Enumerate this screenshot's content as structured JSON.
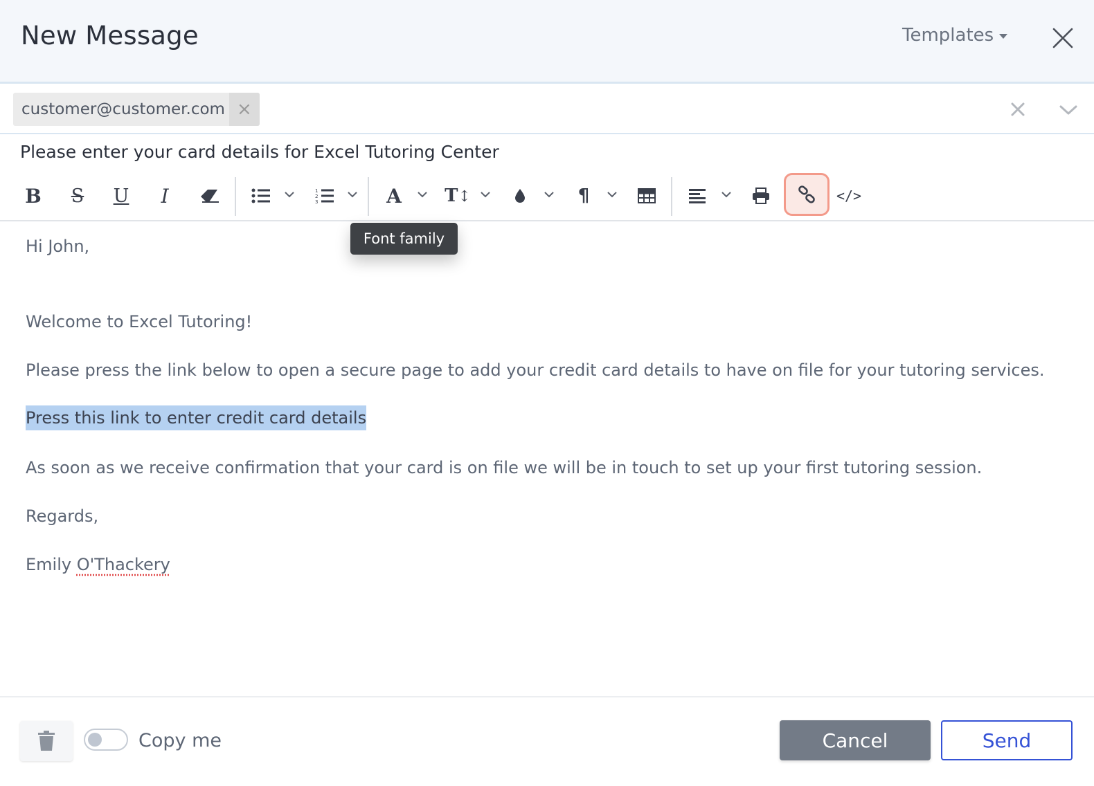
{
  "header": {
    "title": "New Message",
    "templates_label": "Templates"
  },
  "recipients": {
    "chips": [
      "customer@customer.com"
    ]
  },
  "subject": "Please enter your card details for Excel Tutoring Center",
  "toolbar": {
    "tooltip": "Font family",
    "active_button": "insert-link",
    "accent_color": "#f39a8a"
  },
  "message": {
    "greeting": "Hi John,",
    "welcome": "Welcome to Excel Tutoring!",
    "instructions": "Please press the link below to open a secure page to add your credit card details to have on file for your tutoring services.",
    "link_text": "Press this link to enter credit card details",
    "followup": "As soon as we receive confirmation that your card is on file we will be in touch to set up your first tutoring session.",
    "closing": "Regards,",
    "signature_first": "Emily",
    "signature_last": "O'Thackery"
  },
  "footer": {
    "copy_me_label": "Copy me",
    "copy_me_enabled": false,
    "cancel_label": "Cancel",
    "send_label": "Send",
    "send_color": "#3552d6"
  }
}
